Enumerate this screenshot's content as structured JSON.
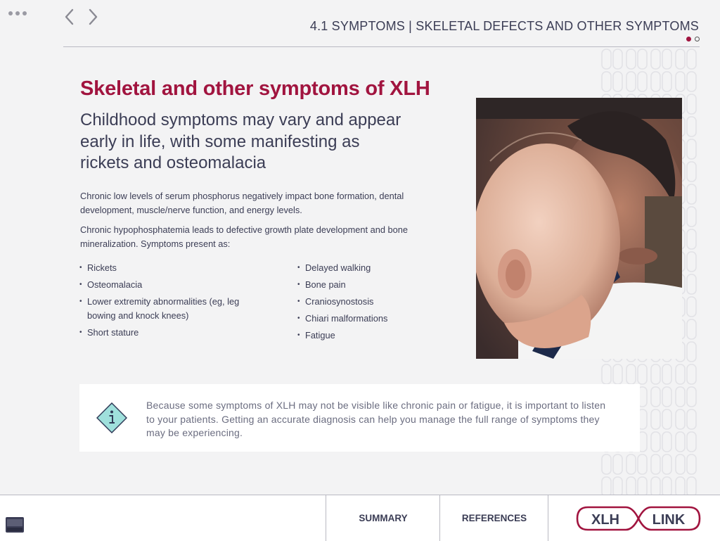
{
  "header": {
    "section_title": "4.1 SYMPTOMS | SKELETAL DEFECTS AND OTHER SYMPTOMS",
    "page_indicator": {
      "current": 1,
      "total": 2
    }
  },
  "icons": {
    "menu": "more-dots-icon",
    "back": "chevron-left-icon",
    "forward": "chevron-right-icon",
    "info": "info-diamond-icon",
    "tray": "tray-icon"
  },
  "content": {
    "heading": "Skeletal and other symptoms of XLH",
    "subheading": "Childhood symptoms may vary and appear early in life, with some manifesting as rickets and osteomalacia",
    "paragraph1": "Chronic low levels of serum phosphorus negatively impact bone formation, dental development, muscle/nerve function, and energy levels.",
    "paragraph2": "Chronic hypophosphatemia leads to defective growth plate development and bone mineralization. Symptoms present as:",
    "symptoms_left": [
      "Rickets",
      "Osteomalacia",
      "Lower extremity abnormalities (eg, leg bowing and knock knees)",
      "Short stature"
    ],
    "symptoms_right": [
      "Delayed walking",
      "Bone pain",
      "Craniosynostosis",
      "Chiari malformations",
      "Fatigue"
    ]
  },
  "info_box": {
    "text": "Because some symptoms of XLH may not be visible like chronic pain or fatigue, it is important to listen to your patients. Getting an accurate diagnosis can help you manage the full range of symptoms they may be experiencing."
  },
  "footer": {
    "summary_label": "SUMMARY",
    "references_label": "REFERENCES",
    "logo_left": "XLH",
    "logo_right": "LINK"
  },
  "colors": {
    "brand": "#a1143f",
    "text": "#3b3d55",
    "background": "#f3f3f4",
    "info_icon_fill": "#9fe0dc"
  }
}
